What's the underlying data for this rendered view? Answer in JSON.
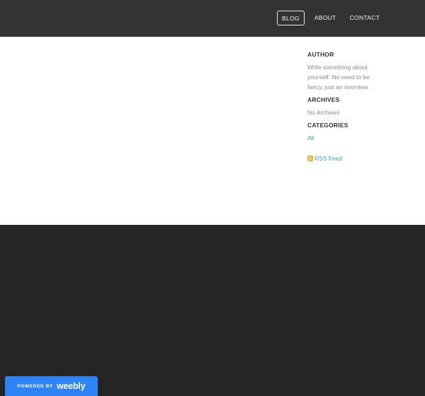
{
  "nav": {
    "items": [
      {
        "label": "BLOG",
        "active": true
      },
      {
        "label": "ABOUT",
        "active": false
      },
      {
        "label": "CONTACT",
        "active": false
      }
    ]
  },
  "sidebar": {
    "author": {
      "heading": "AUTHOR",
      "text": "Write something about yourself. No need to be fancy, just an overview."
    },
    "archives": {
      "heading": "ARCHIVES",
      "text": "No Archives"
    },
    "categories": {
      "heading": "CATEGORIES",
      "link": "All"
    },
    "rss": {
      "label": "RSS Feed",
      "icon": "rss-icon"
    }
  },
  "badge": {
    "powered": "POWERED BY",
    "brand": "weebly"
  },
  "colors": {
    "header": "#333333",
    "footer": "#252525",
    "link": "#3f9fb5",
    "badge": "#2e83f5",
    "rss": "#f0a21c"
  }
}
